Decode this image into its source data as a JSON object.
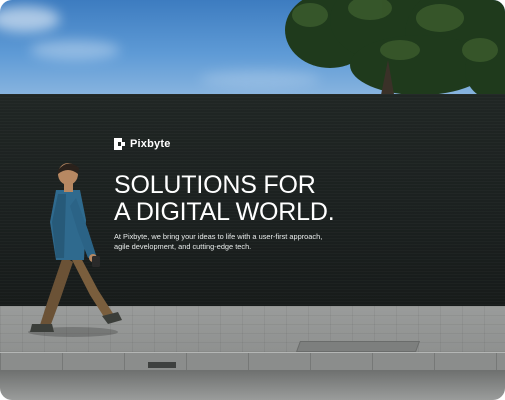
{
  "brand": {
    "name": "Pixbyte",
    "icon": "pixbyte-logo-icon"
  },
  "headline": {
    "line1": "SOLUTIONS FOR",
    "line2": "A DIGITAL WORLD."
  },
  "body_text": {
    "line1": "At Pixbyte, we bring your ideas to life with a user-first approach,",
    "line2": "agile development, and cutting-edge tech."
  },
  "colors": {
    "hoarding": "#1d2221",
    "text": "#ffffff",
    "sky": "#4d8bca"
  }
}
